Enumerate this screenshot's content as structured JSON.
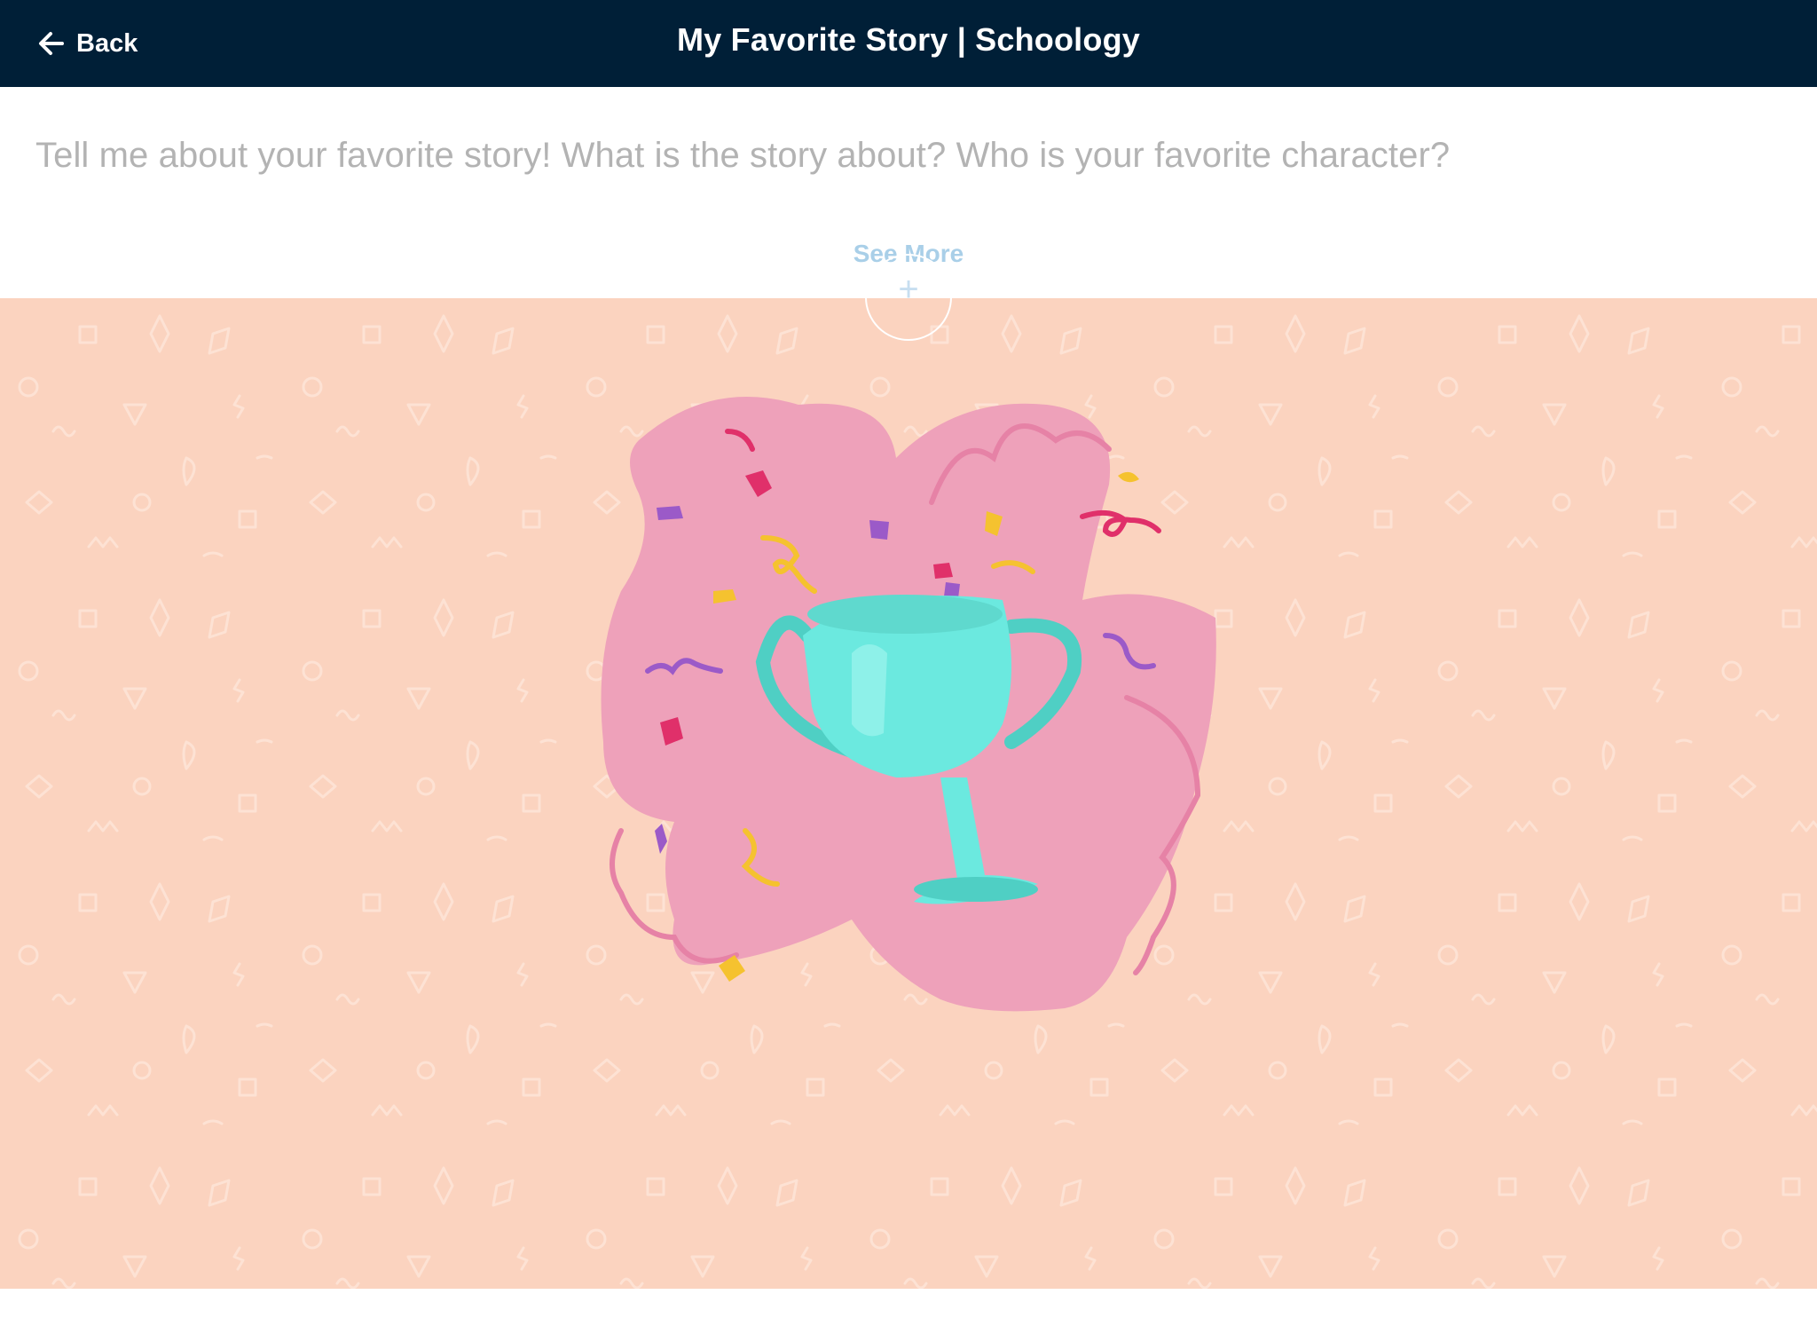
{
  "header": {
    "back_label": "Back",
    "title": "My Favorite Story | Schoology"
  },
  "prompt": {
    "text": "Tell me about your favorite story! What is the story about? Who is your favorite character?",
    "see_more_label": "See More",
    "expand_symbol": "+"
  },
  "colors": {
    "header_bg": "#001f37",
    "canvas_bg": "#fbd3bf",
    "blob": "#eea1ba",
    "trophy": "#6be9df",
    "see_more": "#a9cfe8"
  },
  "icons": {
    "back": "arrow-left-icon",
    "illustration": "trophy-icon"
  }
}
